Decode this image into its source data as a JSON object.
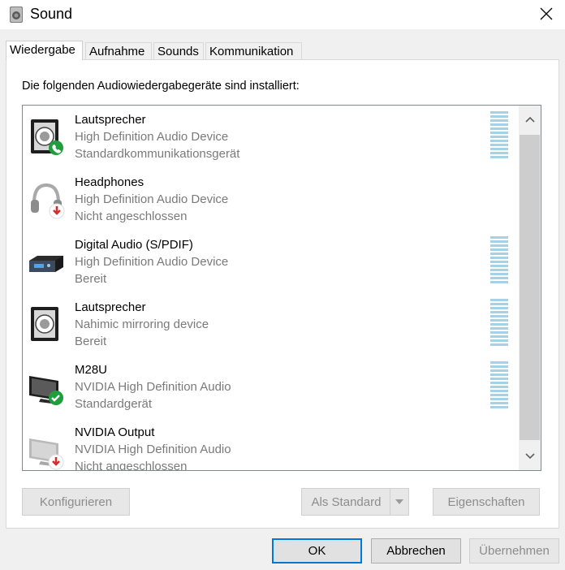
{
  "window": {
    "title": "Sound",
    "icon": "speaker-icon",
    "close_icon": "close-icon"
  },
  "tabs": [
    {
      "label": "Wiedergabe",
      "active": true
    },
    {
      "label": "Aufnahme",
      "active": false
    },
    {
      "label": "Sounds",
      "active": false
    },
    {
      "label": "Kommunikation",
      "active": false
    }
  ],
  "instruction": "Die folgenden Audiowiedergabegeräte sind installiert:",
  "devices": [
    {
      "name": "Lautsprecher",
      "driver": "High Definition Audio Device",
      "status": "Standardkommunikationsgerät",
      "icon": "speaker-icon",
      "badge": "phone-badge",
      "meter": true
    },
    {
      "name": "Headphones",
      "driver": "High Definition Audio Device",
      "status": "Nicht angeschlossen",
      "icon": "headphones-icon",
      "badge": "unplugged-badge",
      "meter": false
    },
    {
      "name": "Digital Audio (S/PDIF)",
      "driver": "High Definition Audio Device",
      "status": "Bereit",
      "icon": "digital-output-icon",
      "badge": "",
      "meter": true
    },
    {
      "name": "Lautsprecher",
      "driver": "Nahimic mirroring device",
      "status": "Bereit",
      "icon": "speaker-icon",
      "badge": "",
      "meter": true
    },
    {
      "name": "M28U",
      "driver": "NVIDIA High Definition Audio",
      "status": "Standardgerät",
      "icon": "monitor-icon",
      "badge": "default-check-badge",
      "meter": true
    },
    {
      "name": "NVIDIA Output",
      "driver": "NVIDIA High Definition Audio",
      "status": "Nicht angeschlossen",
      "icon": "monitor-icon",
      "badge": "unplugged-badge",
      "meter": false
    }
  ],
  "buttons": {
    "configure": "Konfigurieren",
    "set_default": "Als Standard",
    "properties": "Eigenschaften",
    "ok": "OK",
    "cancel": "Abbrechen",
    "apply": "Übernehmen"
  },
  "colors": {
    "accent": "#0078d7",
    "meter": "#a6d2e8",
    "ok_badge": "#1e9e3c",
    "unplugged_badge": "#d32f2f"
  }
}
